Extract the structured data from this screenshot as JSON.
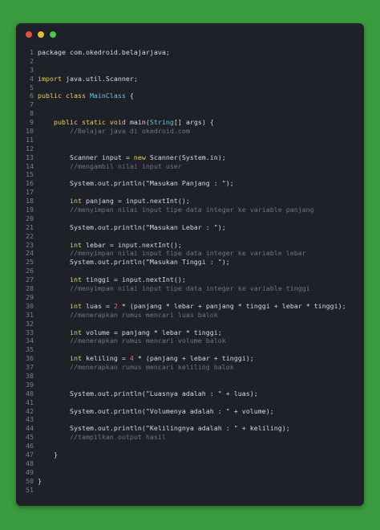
{
  "window": {
    "controls": [
      "close",
      "minimize",
      "maximize"
    ],
    "control_colors": [
      "#e0533e",
      "#e4b93c",
      "#4ec546"
    ]
  },
  "code_lines": [
    [
      {
        "t": "package com.okedroid.belajarjava;",
        "c": ""
      }
    ],
    [],
    [],
    [
      {
        "t": "import ",
        "c": "kw"
      },
      {
        "t": "java.util.Scanner;",
        "c": ""
      }
    ],
    [],
    [
      {
        "t": "public class ",
        "c": "kw"
      },
      {
        "t": "MainClass",
        "c": "cls"
      },
      {
        "t": " {",
        "c": ""
      }
    ],
    [],
    [],
    [
      {
        "t": "    public static void ",
        "c": "kw"
      },
      {
        "t": "main(",
        "c": ""
      },
      {
        "t": "String",
        "c": "cls"
      },
      {
        "t": "[] args) {",
        "c": ""
      }
    ],
    [
      {
        "t": "        //Belajar java di okedroid.com",
        "c": "cm"
      }
    ],
    [],
    [],
    [
      {
        "t": "        Scanner input = ",
        "c": ""
      },
      {
        "t": "new ",
        "c": "kw"
      },
      {
        "t": "Scanner(System.in);",
        "c": ""
      }
    ],
    [
      {
        "t": "        //mengambil nilai input user",
        "c": "cm"
      }
    ],
    [],
    [
      {
        "t": "        System.out.println(\"Masukan Panjang : \");",
        "c": ""
      }
    ],
    [],
    [
      {
        "t": "        int ",
        "c": "kw"
      },
      {
        "t": "panjang = input.nextInt();",
        "c": ""
      }
    ],
    [
      {
        "t": "        //menyimpan nilai input tipe data integer ke variable panjang",
        "c": "cm"
      }
    ],
    [],
    [
      {
        "t": "        System.out.println(\"Masukan Lebar : \");",
        "c": ""
      }
    ],
    [],
    [
      {
        "t": "        int ",
        "c": "kw"
      },
      {
        "t": "lebar = input.nextInt();",
        "c": ""
      }
    ],
    [
      {
        "t": "        //menyimpan nilai input tipe data integer ke variable lebar",
        "c": "cm"
      }
    ],
    [
      {
        "t": "        System.out.println(\"Masukan Tinggi : \");",
        "c": ""
      }
    ],
    [],
    [
      {
        "t": "        int ",
        "c": "kw"
      },
      {
        "t": "tinggi = input.nextInt();",
        "c": ""
      }
    ],
    [
      {
        "t": "        //menyimpan nilai input tipe data integer ke variable tinggi",
        "c": "cm"
      }
    ],
    [],
    [
      {
        "t": "        int ",
        "c": "kw"
      },
      {
        "t": "luas = ",
        "c": ""
      },
      {
        "t": "2",
        "c": "numv"
      },
      {
        "t": " * (panjang * lebar + panjang * tinggi + lebar * tinggi);",
        "c": ""
      }
    ],
    [
      {
        "t": "        //menerapkan rumus mencari luas balok",
        "c": "cm"
      }
    ],
    [],
    [
      {
        "t": "        int ",
        "c": "kw"
      },
      {
        "t": "volume = panjang * lebar * tinggi;",
        "c": ""
      }
    ],
    [
      {
        "t": "        //menerapkan rumus mencari volume balok",
        "c": "cm"
      }
    ],
    [],
    [
      {
        "t": "        int ",
        "c": "kw"
      },
      {
        "t": "keliling = ",
        "c": ""
      },
      {
        "t": "4",
        "c": "numv"
      },
      {
        "t": " * (panjang + lebar + tinggi);",
        "c": ""
      }
    ],
    [
      {
        "t": "        //menerapkan rumus mencari keliling balok",
        "c": "cm"
      }
    ],
    [],
    [],
    [
      {
        "t": "        System.out.println(\"Luasnya adalah : \" + luas);",
        "c": ""
      }
    ],
    [],
    [
      {
        "t": "        System.out.println(\"Volumenya adalah : \" + volume);",
        "c": ""
      }
    ],
    [],
    [
      {
        "t": "        System.out.println(\"Kelilingnya adalah : \" + keliling);",
        "c": ""
      }
    ],
    [
      {
        "t": "        //tampilkan output hasil",
        "c": "cm"
      }
    ],
    [],
    [
      {
        "t": "    }",
        "c": ""
      }
    ],
    [],
    [],
    [
      {
        "t": "}",
        "c": ""
      }
    ],
    []
  ]
}
